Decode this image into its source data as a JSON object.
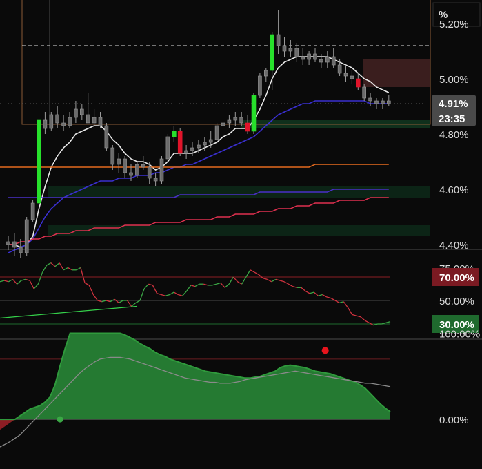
{
  "chart_data": [
    {
      "type": "candlestick",
      "unit": "%",
      "ylim": [
        4.4,
        5.3
      ],
      "y_ticks": [
        {
          "value": 5.2,
          "label": "5.20%"
        },
        {
          "value": 5.0,
          "label": "5.00%"
        },
        {
          "value": 4.8,
          "label": "4.80%"
        },
        {
          "value": 4.6,
          "label": "4.60%"
        },
        {
          "value": 4.4,
          "label": "4.40%"
        }
      ],
      "current_price": {
        "value": 4.91,
        "label": "4.91%",
        "countdown": "23:35"
      },
      "dashed_level": 5.12,
      "candles": [
        [
          4.4,
          4.43,
          4.38,
          4.41
        ],
        [
          4.41,
          4.44,
          4.36,
          4.39
        ],
        [
          4.39,
          4.42,
          4.35,
          4.37
        ],
        [
          4.37,
          4.5,
          4.36,
          4.49
        ],
        [
          4.49,
          4.56,
          4.48,
          4.55
        ],
        [
          4.55,
          4.86,
          4.54,
          4.85
        ],
        [
          4.85,
          4.88,
          4.8,
          4.82
        ],
        [
          4.82,
          4.88,
          4.81,
          4.87
        ],
        [
          4.87,
          4.9,
          4.82,
          4.84
        ],
        [
          4.84,
          4.87,
          4.81,
          4.83
        ],
        [
          4.83,
          4.88,
          4.82,
          4.86
        ],
        [
          4.86,
          4.92,
          4.84,
          4.89
        ],
        [
          4.89,
          4.91,
          4.85,
          4.87
        ],
        [
          4.87,
          4.95,
          4.84,
          4.84
        ],
        [
          4.84,
          4.89,
          4.83,
          4.86
        ],
        [
          4.86,
          4.88,
          4.82,
          4.83
        ],
        [
          4.83,
          4.84,
          4.74,
          4.75
        ],
        [
          4.75,
          4.76,
          4.67,
          4.69
        ],
        [
          4.69,
          4.73,
          4.66,
          4.71
        ],
        [
          4.71,
          4.72,
          4.64,
          4.66
        ],
        [
          4.66,
          4.69,
          4.63,
          4.65
        ],
        [
          4.65,
          4.7,
          4.64,
          4.69
        ],
        [
          4.69,
          4.72,
          4.67,
          4.68
        ],
        [
          4.68,
          4.7,
          4.62,
          4.64
        ],
        [
          4.64,
          4.66,
          4.61,
          4.63
        ],
        [
          4.63,
          4.72,
          4.62,
          4.71
        ],
        [
          4.71,
          4.8,
          4.7,
          4.79
        ],
        [
          4.79,
          4.83,
          4.77,
          4.81
        ],
        [
          4.81,
          4.82,
          4.72,
          4.73
        ],
        [
          4.73,
          4.76,
          4.71,
          4.74
        ],
        [
          4.74,
          4.77,
          4.72,
          4.75
        ],
        [
          4.75,
          4.78,
          4.73,
          4.76
        ],
        [
          4.76,
          4.79,
          4.74,
          4.77
        ],
        [
          4.77,
          4.81,
          4.75,
          4.78
        ],
        [
          4.78,
          4.84,
          4.77,
          4.83
        ],
        [
          4.83,
          4.86,
          4.81,
          4.84
        ],
        [
          4.84,
          4.87,
          4.82,
          4.85
        ],
        [
          4.85,
          4.88,
          4.83,
          4.86
        ],
        [
          4.86,
          4.88,
          4.83,
          4.84
        ],
        [
          4.84,
          4.87,
          4.8,
          4.81
        ],
        [
          4.81,
          4.95,
          4.8,
          4.94
        ],
        [
          4.94,
          5.02,
          4.93,
          5.01
        ],
        [
          5.01,
          5.04,
          4.99,
          5.03
        ],
        [
          5.03,
          5.17,
          4.96,
          5.16
        ],
        [
          5.16,
          5.25,
          5.09,
          5.12
        ],
        [
          5.12,
          5.15,
          5.08,
          5.1
        ],
        [
          5.1,
          5.14,
          5.08,
          5.11
        ],
        [
          5.11,
          5.13,
          5.06,
          5.08
        ],
        [
          5.08,
          5.11,
          5.05,
          5.07
        ],
        [
          5.07,
          5.1,
          5.05,
          5.09
        ],
        [
          5.09,
          5.11,
          5.06,
          5.07
        ],
        [
          5.07,
          5.09,
          5.04,
          5.06
        ],
        [
          5.06,
          5.1,
          5.04,
          5.08
        ],
        [
          5.08,
          5.11,
          5.04,
          5.05
        ],
        [
          5.05,
          5.07,
          5.01,
          5.02
        ],
        [
          5.02,
          5.05,
          4.99,
          5.01
        ],
        [
          5.01,
          5.03,
          4.98,
          5.0
        ],
        [
          5.0,
          5.02,
          4.96,
          4.97
        ],
        [
          4.97,
          4.98,
          4.92,
          4.93
        ],
        [
          4.93,
          4.95,
          4.9,
          4.92
        ],
        [
          4.92,
          4.93,
          4.89,
          4.91
        ],
        [
          4.91,
          4.93,
          4.89,
          4.92
        ],
        [
          4.92,
          4.94,
          4.9,
          4.91
        ]
      ],
      "highlight_up_candles": [
        5,
        27,
        40,
        43
      ],
      "highlight_down_candles": [
        28,
        39,
        57
      ],
      "zones": [
        {
          "kind": "supply",
          "from": 4.97,
          "to": 5.07,
          "color": "#3a1e1e"
        },
        {
          "kind": "demand",
          "from": 4.82,
          "to": 4.85,
          "color": "#10301c"
        },
        {
          "kind": "demand",
          "from": 4.57,
          "to": 4.61,
          "color": "#0c2416"
        },
        {
          "kind": "demand",
          "from": 4.43,
          "to": 4.47,
          "color": "#0c2416"
        }
      ],
      "moving_averages": [
        {
          "color": "#e8e8e8",
          "values": [
            4.4,
            4.4,
            4.39,
            4.4,
            4.43,
            4.53,
            4.61,
            4.68,
            4.72,
            4.75,
            4.77,
            4.8,
            4.81,
            4.82,
            4.83,
            4.83,
            4.81,
            4.78,
            4.76,
            4.73,
            4.71,
            4.7,
            4.7,
            4.69,
            4.67,
            4.68,
            4.7,
            4.73,
            4.73,
            4.73,
            4.73,
            4.74,
            4.75,
            4.76,
            4.77,
            4.79,
            4.8,
            4.82,
            4.82,
            4.82,
            4.85,
            4.89,
            4.94,
            5.0,
            5.04,
            5.06,
            5.07,
            5.08,
            5.08,
            5.08,
            5.08,
            5.08,
            5.08,
            5.07,
            5.06,
            5.05,
            5.04,
            5.02,
            5.0,
            4.99,
            4.97,
            4.96,
            4.95
          ]
        },
        {
          "color": "#3a2fd0",
          "values": [
            4.37,
            4.38,
            4.39,
            4.4,
            4.42,
            4.46,
            4.5,
            4.53,
            4.55,
            4.57,
            4.58,
            4.59,
            4.6,
            4.61,
            4.62,
            4.63,
            4.63,
            4.63,
            4.64,
            4.64,
            4.64,
            4.65,
            4.65,
            4.65,
            4.66,
            4.66,
            4.67,
            4.68,
            4.68,
            4.69,
            4.69,
            4.7,
            4.71,
            4.72,
            4.73,
            4.74,
            4.75,
            4.76,
            4.77,
            4.78,
            4.79,
            4.81,
            4.83,
            4.85,
            4.87,
            4.88,
            4.89,
            4.9,
            4.91,
            4.91,
            4.92,
            4.92,
            4.92,
            4.92,
            4.92,
            4.92,
            4.92,
            4.92,
            4.92,
            4.91,
            4.91,
            4.91,
            4.91
          ]
        },
        {
          "color": "#e46a1e",
          "values": [
            4.68,
            4.68,
            4.68,
            4.68,
            4.68,
            4.68,
            4.68,
            4.68,
            4.68,
            4.68,
            4.68,
            4.68,
            4.68,
            4.68,
            4.68,
            4.68,
            4.68,
            4.68,
            4.68,
            4.68,
            4.68,
            4.68,
            4.68,
            4.68,
            4.68,
            4.68,
            4.68,
            4.68,
            4.68,
            4.68,
            4.68,
            4.68,
            4.68,
            4.68,
            4.68,
            4.68,
            4.68,
            4.68,
            4.68,
            4.68,
            4.68,
            4.68,
            4.68,
            4.68,
            4.68,
            4.68,
            4.68,
            4.68,
            4.68,
            4.68,
            4.69,
            4.69,
            4.69,
            4.69,
            4.69,
            4.69,
            4.69,
            4.69,
            4.69,
            4.69,
            4.69,
            4.69,
            4.69
          ]
        },
        {
          "color": "#4a2fc8",
          "values": [
            4.57,
            4.57,
            4.57,
            4.57,
            4.57,
            4.57,
            4.57,
            4.57,
            4.57,
            4.57,
            4.57,
            4.57,
            4.57,
            4.57,
            4.57,
            4.57,
            4.57,
            4.57,
            4.57,
            4.57,
            4.57,
            4.57,
            4.57,
            4.57,
            4.57,
            4.57,
            4.57,
            4.57,
            4.58,
            4.58,
            4.58,
            4.58,
            4.58,
            4.58,
            4.58,
            4.58,
            4.58,
            4.58,
            4.58,
            4.58,
            4.58,
            4.59,
            4.59,
            4.59,
            4.59,
            4.59,
            4.59,
            4.59,
            4.59,
            4.59,
            4.59,
            4.59,
            4.59,
            4.6,
            4.6,
            4.6,
            4.6,
            4.6,
            4.6,
            4.6,
            4.6,
            4.6,
            4.6
          ]
        },
        {
          "color": "#e0304f",
          "values": [
            4.4,
            4.4,
            4.41,
            4.41,
            4.42,
            4.42,
            4.43,
            4.43,
            4.44,
            4.44,
            4.44,
            4.45,
            4.45,
            4.45,
            4.46,
            4.46,
            4.46,
            4.46,
            4.46,
            4.47,
            4.47,
            4.47,
            4.47,
            4.47,
            4.48,
            4.48,
            4.48,
            4.48,
            4.48,
            4.49,
            4.49,
            4.49,
            4.49,
            4.49,
            4.5,
            4.5,
            4.5,
            4.51,
            4.51,
            4.51,
            4.51,
            4.52,
            4.52,
            4.52,
            4.53,
            4.53,
            4.53,
            4.54,
            4.54,
            4.54,
            4.55,
            4.55,
            4.55,
            4.55,
            4.56,
            4.56,
            4.56,
            4.56,
            4.56,
            4.57,
            4.57,
            4.57,
            4.57
          ]
        }
      ]
    },
    {
      "type": "line",
      "ylim": [
        0,
        100
      ],
      "levels": [
        {
          "value": 70,
          "label": "70.00%",
          "color": "#8c1d24"
        },
        {
          "value": 50,
          "label": "50.00%",
          "color": "#4a4a4a"
        },
        {
          "value": 30,
          "label": "30.00%",
          "color": "#1f6a2e"
        }
      ],
      "partial_top_label": "75.00%",
      "partial_bottom_label": "25.00%",
      "series_values": [
        66,
        67,
        66,
        68,
        64,
        67,
        68,
        67,
        60,
        64,
        74,
        80,
        82,
        79,
        82,
        76,
        78,
        76,
        76,
        78,
        65,
        63,
        55,
        50,
        49,
        50,
        49,
        51,
        48,
        50,
        50,
        45,
        48,
        50,
        60,
        64,
        63,
        56,
        55,
        54,
        55,
        57,
        55,
        54,
        58,
        63,
        62,
        64,
        64,
        63,
        63,
        64,
        65,
        61,
        64,
        70,
        66,
        64,
        70,
        76,
        74,
        72,
        69,
        68,
        66,
        68,
        67,
        66,
        64,
        62,
        61,
        61,
        58,
        56,
        57,
        54,
        55,
        53,
        52,
        50,
        48,
        49,
        44,
        38,
        37,
        36,
        33,
        31,
        29,
        30,
        30,
        31,
        32
      ],
      "diagonal": {
        "from": [
          0,
          35
        ],
        "to": [
          0.35,
          45
        ],
        "color": "#35d04a"
      }
    },
    {
      "type": "area",
      "ylim": [
        -40,
        110
      ],
      "y_ticks": [
        {
          "value": 100,
          "label": "100.00%"
        },
        {
          "value": 0,
          "label": "0.00%"
        }
      ],
      "level_lines": [
        {
          "value": 70,
          "color": "#6a1d22"
        },
        {
          "value": -70,
          "color": "#1e5a2a"
        }
      ],
      "histogram": [
        -12,
        -8,
        -4,
        0,
        4,
        8,
        12,
        14,
        16,
        20,
        26,
        40,
        62,
        82,
        100,
        100,
        100,
        100,
        100,
        100,
        100,
        100,
        100,
        100,
        100,
        98,
        95,
        92,
        88,
        85,
        82,
        78,
        75,
        73,
        70,
        68,
        66,
        64,
        62,
        60,
        58,
        56,
        55,
        54,
        53,
        52,
        51,
        50,
        49,
        48,
        48,
        49,
        50,
        52,
        54,
        56,
        60,
        62,
        63,
        62,
        61,
        60,
        58,
        56,
        55,
        54,
        53,
        51,
        49,
        47,
        45,
        43,
        40,
        36,
        30,
        24,
        18,
        13,
        9
      ],
      "signal": [
        -32,
        -29,
        -26,
        -22,
        -18,
        -12,
        -6,
        0,
        6,
        12,
        18,
        24,
        30,
        36,
        42,
        48,
        54,
        59,
        63,
        67,
        70,
        71,
        72,
        72,
        72,
        71,
        70,
        68,
        66,
        64,
        62,
        60,
        58,
        56,
        54,
        52,
        50,
        48,
        47,
        46,
        45,
        44,
        43,
        43,
        42,
        42,
        42,
        43,
        44,
        46,
        47,
        48,
        49,
        50,
        51,
        52,
        53,
        54,
        55,
        56,
        55,
        54,
        53,
        52,
        51,
        50,
        49,
        48,
        47,
        46,
        45,
        44,
        43,
        42,
        42,
        41,
        40,
        39,
        38
      ],
      "marker_red": {
        "index": 65,
        "value": 80
      },
      "marker_green": {
        "index": 12,
        "value": 0
      }
    }
  ],
  "ui": {
    "unit_label": "%"
  }
}
